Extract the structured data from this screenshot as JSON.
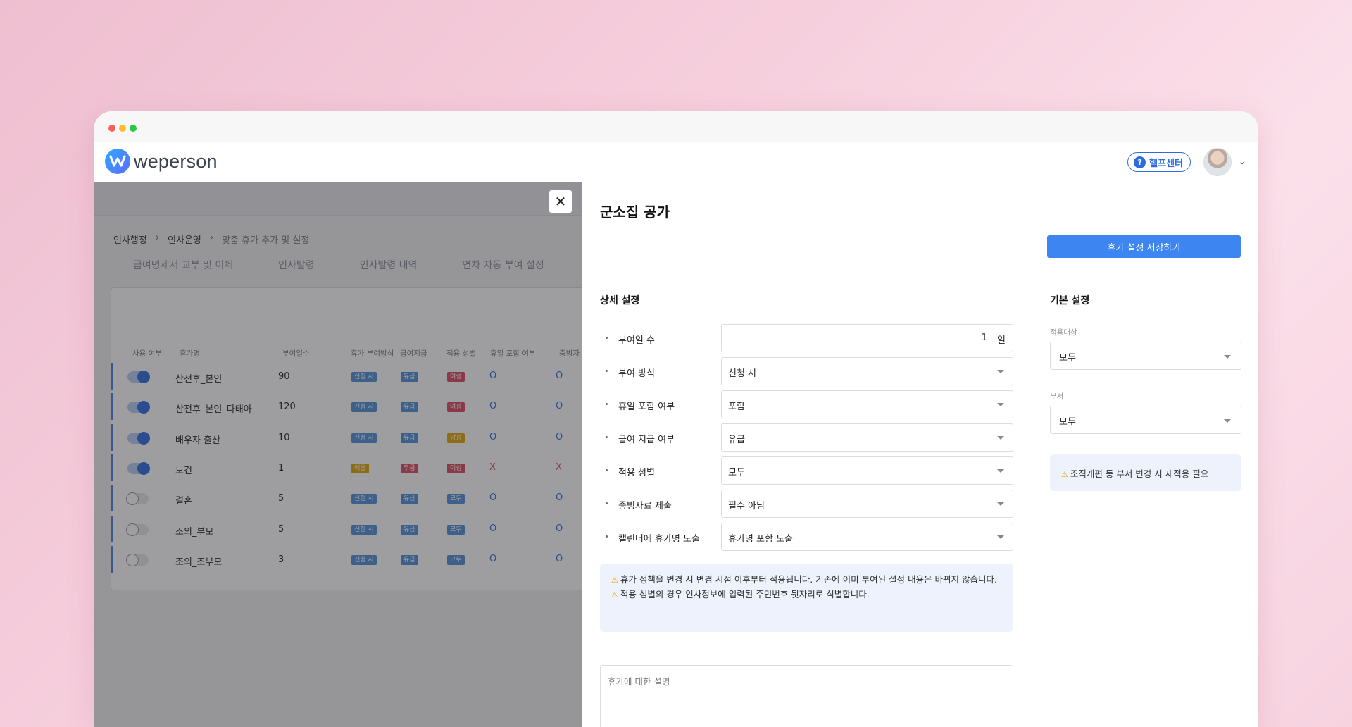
{
  "app": {
    "logo_text": "weperson",
    "help_label": "헬프센터"
  },
  "background_page": {
    "breadcrumb": [
      "인사행정",
      "인사운영",
      "맞춤 휴가 추가 및 설정"
    ],
    "tabs": [
      "급여명세서 교부 및 이체",
      "인사발령",
      "인사발령 내역",
      "연차 자동 부여 설정"
    ],
    "columns": [
      "사용 여부",
      "휴가명",
      "부여일수",
      "휴가 부여방식",
      "급여지급",
      "적용 성별",
      "휴일 포함 여부",
      "증빙자"
    ],
    "rows": [
      {
        "enabled": true,
        "name": "산전후_본인",
        "days": "90",
        "grant": "신청 시",
        "pay": "유급",
        "gender": "여성",
        "holiday": "O",
        "proof": "O"
      },
      {
        "enabled": true,
        "name": "산전후_본인_다태아",
        "days": "120",
        "grant": "신청 시",
        "pay": "유급",
        "gender": "여성",
        "holiday": "O",
        "proof": "O"
      },
      {
        "enabled": true,
        "name": "배우자 출산",
        "days": "10",
        "grant": "신청 시",
        "pay": "유급",
        "gender": "남성",
        "holiday": "O",
        "proof": "O"
      },
      {
        "enabled": true,
        "name": "보건",
        "days": "1",
        "grant": "매월",
        "pay": "무급",
        "gender": "여성",
        "holiday": "X",
        "proof": "X"
      },
      {
        "enabled": false,
        "name": "결혼",
        "days": "5",
        "grant": "신청 시",
        "pay": "유급",
        "gender": "모두",
        "holiday": "O",
        "proof": "O"
      },
      {
        "enabled": false,
        "name": "조의_부모",
        "days": "5",
        "grant": "신청 시",
        "pay": "유급",
        "gender": "모두",
        "holiday": "O",
        "proof": "O"
      },
      {
        "enabled": false,
        "name": "조의_조부모",
        "days": "3",
        "grant": "신청 시",
        "pay": "유급",
        "gender": "모두",
        "holiday": "O",
        "proof": "O"
      }
    ]
  },
  "panel": {
    "title": "군소집 공가",
    "save_label": "휴가 설정 저장하기",
    "detail": {
      "title": "상세 설정",
      "fields": [
        {
          "label": "부여일 수",
          "value": "1",
          "unit": "일"
        },
        {
          "label": "부여 방식",
          "value": "신청 시"
        },
        {
          "label": "휴일 포함 여부",
          "value": "포함"
        },
        {
          "label": "급여 지급 여부",
          "value": "유급"
        },
        {
          "label": "적용 성별",
          "value": "모두"
        },
        {
          "label": "증빙자료 제출",
          "value": "필수 아님"
        },
        {
          "label": "캘린더에 휴가명 노출",
          "value": "휴가명 포함 노출"
        }
      ],
      "notice_1": "휴가 정책을 변경 시 변경 시점 이후부터 적용됩니다. 기존에 이미 부여된 설정 내용은 바뀌지 않습니다.",
      "notice_2": "적용 성별의 경우 인사정보에 입력된 주민번호 뒷자리로 식별합니다.",
      "description_placeholder": "휴가에 대한 설명"
    },
    "basic": {
      "title": "기본 설정",
      "target_label": "적용대상",
      "target_value": "모두",
      "dept_label": "부서",
      "dept_value": "모두",
      "notice": "조직개편 등 부서 변경 시 재적용 필요"
    }
  }
}
